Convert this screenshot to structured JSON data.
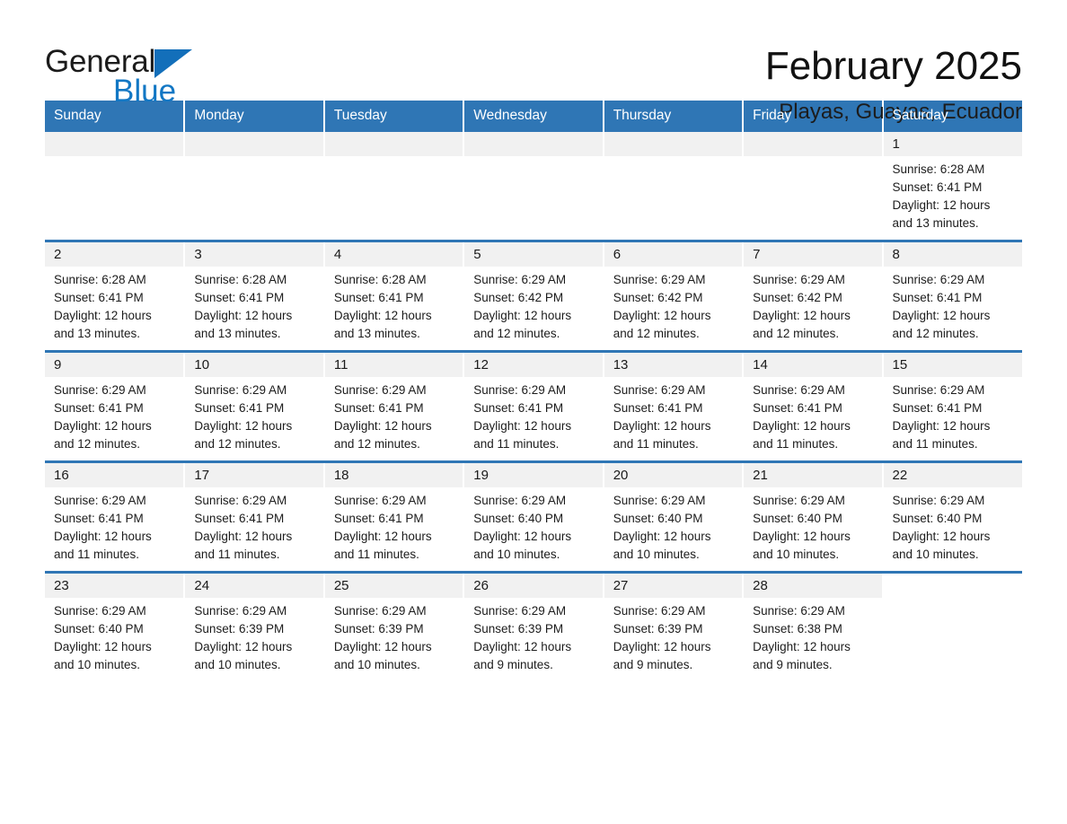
{
  "brand": {
    "name_part1": "General",
    "name_part2": "Blue",
    "flag_icon": "triangle-flag-icon",
    "accent_color": "#1277c4"
  },
  "header": {
    "month_title": "February 2025",
    "location": "Playas, Guayas, Ecuador"
  },
  "calendar": {
    "header_color": "#2f76b5",
    "daynum_bar_color": "#f1f1f1",
    "weekday_headers": [
      "Sunday",
      "Monday",
      "Tuesday",
      "Wednesday",
      "Thursday",
      "Friday",
      "Saturday"
    ],
    "weeks": [
      [
        {
          "day": "",
          "state": "empty",
          "sunrise": "",
          "sunset": "",
          "daylight_line1": "",
          "daylight_line2": ""
        },
        {
          "day": "",
          "state": "empty",
          "sunrise": "",
          "sunset": "",
          "daylight_line1": "",
          "daylight_line2": ""
        },
        {
          "day": "",
          "state": "empty",
          "sunrise": "",
          "sunset": "",
          "daylight_line1": "",
          "daylight_line2": ""
        },
        {
          "day": "",
          "state": "empty",
          "sunrise": "",
          "sunset": "",
          "daylight_line1": "",
          "daylight_line2": ""
        },
        {
          "day": "",
          "state": "empty",
          "sunrise": "",
          "sunset": "",
          "daylight_line1": "",
          "daylight_line2": ""
        },
        {
          "day": "",
          "state": "empty",
          "sunrise": "",
          "sunset": "",
          "daylight_line1": "",
          "daylight_line2": ""
        },
        {
          "day": "1",
          "state": "filled",
          "sunrise": "Sunrise: 6:28 AM",
          "sunset": "Sunset: 6:41 PM",
          "daylight_line1": "Daylight: 12 hours",
          "daylight_line2": "and 13 minutes."
        }
      ],
      [
        {
          "day": "2",
          "state": "filled",
          "sunrise": "Sunrise: 6:28 AM",
          "sunset": "Sunset: 6:41 PM",
          "daylight_line1": "Daylight: 12 hours",
          "daylight_line2": "and 13 minutes."
        },
        {
          "day": "3",
          "state": "filled",
          "sunrise": "Sunrise: 6:28 AM",
          "sunset": "Sunset: 6:41 PM",
          "daylight_line1": "Daylight: 12 hours",
          "daylight_line2": "and 13 minutes."
        },
        {
          "day": "4",
          "state": "filled",
          "sunrise": "Sunrise: 6:28 AM",
          "sunset": "Sunset: 6:41 PM",
          "daylight_line1": "Daylight: 12 hours",
          "daylight_line2": "and 13 minutes."
        },
        {
          "day": "5",
          "state": "filled",
          "sunrise": "Sunrise: 6:29 AM",
          "sunset": "Sunset: 6:42 PM",
          "daylight_line1": "Daylight: 12 hours",
          "daylight_line2": "and 12 minutes."
        },
        {
          "day": "6",
          "state": "filled",
          "sunrise": "Sunrise: 6:29 AM",
          "sunset": "Sunset: 6:42 PM",
          "daylight_line1": "Daylight: 12 hours",
          "daylight_line2": "and 12 minutes."
        },
        {
          "day": "7",
          "state": "filled",
          "sunrise": "Sunrise: 6:29 AM",
          "sunset": "Sunset: 6:42 PM",
          "daylight_line1": "Daylight: 12 hours",
          "daylight_line2": "and 12 minutes."
        },
        {
          "day": "8",
          "state": "filled",
          "sunrise": "Sunrise: 6:29 AM",
          "sunset": "Sunset: 6:41 PM",
          "daylight_line1": "Daylight: 12 hours",
          "daylight_line2": "and 12 minutes."
        }
      ],
      [
        {
          "day": "9",
          "state": "filled",
          "sunrise": "Sunrise: 6:29 AM",
          "sunset": "Sunset: 6:41 PM",
          "daylight_line1": "Daylight: 12 hours",
          "daylight_line2": "and 12 minutes."
        },
        {
          "day": "10",
          "state": "filled",
          "sunrise": "Sunrise: 6:29 AM",
          "sunset": "Sunset: 6:41 PM",
          "daylight_line1": "Daylight: 12 hours",
          "daylight_line2": "and 12 minutes."
        },
        {
          "day": "11",
          "state": "filled",
          "sunrise": "Sunrise: 6:29 AM",
          "sunset": "Sunset: 6:41 PM",
          "daylight_line1": "Daylight: 12 hours",
          "daylight_line2": "and 12 minutes."
        },
        {
          "day": "12",
          "state": "filled",
          "sunrise": "Sunrise: 6:29 AM",
          "sunset": "Sunset: 6:41 PM",
          "daylight_line1": "Daylight: 12 hours",
          "daylight_line2": "and 11 minutes."
        },
        {
          "day": "13",
          "state": "filled",
          "sunrise": "Sunrise: 6:29 AM",
          "sunset": "Sunset: 6:41 PM",
          "daylight_line1": "Daylight: 12 hours",
          "daylight_line2": "and 11 minutes."
        },
        {
          "day": "14",
          "state": "filled",
          "sunrise": "Sunrise: 6:29 AM",
          "sunset": "Sunset: 6:41 PM",
          "daylight_line1": "Daylight: 12 hours",
          "daylight_line2": "and 11 minutes."
        },
        {
          "day": "15",
          "state": "filled",
          "sunrise": "Sunrise: 6:29 AM",
          "sunset": "Sunset: 6:41 PM",
          "daylight_line1": "Daylight: 12 hours",
          "daylight_line2": "and 11 minutes."
        }
      ],
      [
        {
          "day": "16",
          "state": "filled",
          "sunrise": "Sunrise: 6:29 AM",
          "sunset": "Sunset: 6:41 PM",
          "daylight_line1": "Daylight: 12 hours",
          "daylight_line2": "and 11 minutes."
        },
        {
          "day": "17",
          "state": "filled",
          "sunrise": "Sunrise: 6:29 AM",
          "sunset": "Sunset: 6:41 PM",
          "daylight_line1": "Daylight: 12 hours",
          "daylight_line2": "and 11 minutes."
        },
        {
          "day": "18",
          "state": "filled",
          "sunrise": "Sunrise: 6:29 AM",
          "sunset": "Sunset: 6:41 PM",
          "daylight_line1": "Daylight: 12 hours",
          "daylight_line2": "and 11 minutes."
        },
        {
          "day": "19",
          "state": "filled",
          "sunrise": "Sunrise: 6:29 AM",
          "sunset": "Sunset: 6:40 PM",
          "daylight_line1": "Daylight: 12 hours",
          "daylight_line2": "and 10 minutes."
        },
        {
          "day": "20",
          "state": "filled",
          "sunrise": "Sunrise: 6:29 AM",
          "sunset": "Sunset: 6:40 PM",
          "daylight_line1": "Daylight: 12 hours",
          "daylight_line2": "and 10 minutes."
        },
        {
          "day": "21",
          "state": "filled",
          "sunrise": "Sunrise: 6:29 AM",
          "sunset": "Sunset: 6:40 PM",
          "daylight_line1": "Daylight: 12 hours",
          "daylight_line2": "and 10 minutes."
        },
        {
          "day": "22",
          "state": "filled",
          "sunrise": "Sunrise: 6:29 AM",
          "sunset": "Sunset: 6:40 PM",
          "daylight_line1": "Daylight: 12 hours",
          "daylight_line2": "and 10 minutes."
        }
      ],
      [
        {
          "day": "23",
          "state": "filled",
          "sunrise": "Sunrise: 6:29 AM",
          "sunset": "Sunset: 6:40 PM",
          "daylight_line1": "Daylight: 12 hours",
          "daylight_line2": "and 10 minutes."
        },
        {
          "day": "24",
          "state": "filled",
          "sunrise": "Sunrise: 6:29 AM",
          "sunset": "Sunset: 6:39 PM",
          "daylight_line1": "Daylight: 12 hours",
          "daylight_line2": "and 10 minutes."
        },
        {
          "day": "25",
          "state": "filled",
          "sunrise": "Sunrise: 6:29 AM",
          "sunset": "Sunset: 6:39 PM",
          "daylight_line1": "Daylight: 12 hours",
          "daylight_line2": "and 10 minutes."
        },
        {
          "day": "26",
          "state": "filled",
          "sunrise": "Sunrise: 6:29 AM",
          "sunset": "Sunset: 6:39 PM",
          "daylight_line1": "Daylight: 12 hours",
          "daylight_line2": "and 9 minutes."
        },
        {
          "day": "27",
          "state": "filled",
          "sunrise": "Sunrise: 6:29 AM",
          "sunset": "Sunset: 6:39 PM",
          "daylight_line1": "Daylight: 12 hours",
          "daylight_line2": "and 9 minutes."
        },
        {
          "day": "28",
          "state": "filled",
          "sunrise": "Sunrise: 6:29 AM",
          "sunset": "Sunset: 6:38 PM",
          "daylight_line1": "Daylight: 12 hours",
          "daylight_line2": "and 9 minutes."
        },
        {
          "day": "",
          "state": "blank",
          "sunrise": "",
          "sunset": "",
          "daylight_line1": "",
          "daylight_line2": ""
        }
      ]
    ]
  }
}
